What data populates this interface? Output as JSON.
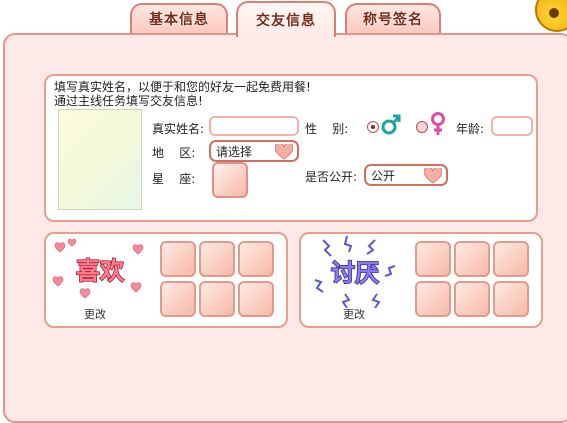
{
  "tabs": [
    {
      "label": "基本信息"
    },
    {
      "label": "交友信息"
    },
    {
      "label": "称号签名"
    }
  ],
  "notice": {
    "line1": "填写真实姓名，以便于和您的好友一起免费用餐!",
    "line2": "通过主线任务填写交友信息!"
  },
  "form": {
    "real_name_label": "真实姓名:",
    "real_name_value": "",
    "gender_label": "性    别:",
    "age_label": "年龄:",
    "age_value": "",
    "region_label": "地    区:",
    "region_value": "请选择",
    "constellation_label": "星    座:",
    "public_label": "是否公开:",
    "public_value": "公开"
  },
  "likes": {
    "title": "喜欢",
    "change_label": "更改"
  },
  "dislikes": {
    "title": "讨厌",
    "change_label": "更改"
  },
  "colors": {
    "accent": "#e0958d",
    "panel_bg": "#ffe9e8"
  }
}
